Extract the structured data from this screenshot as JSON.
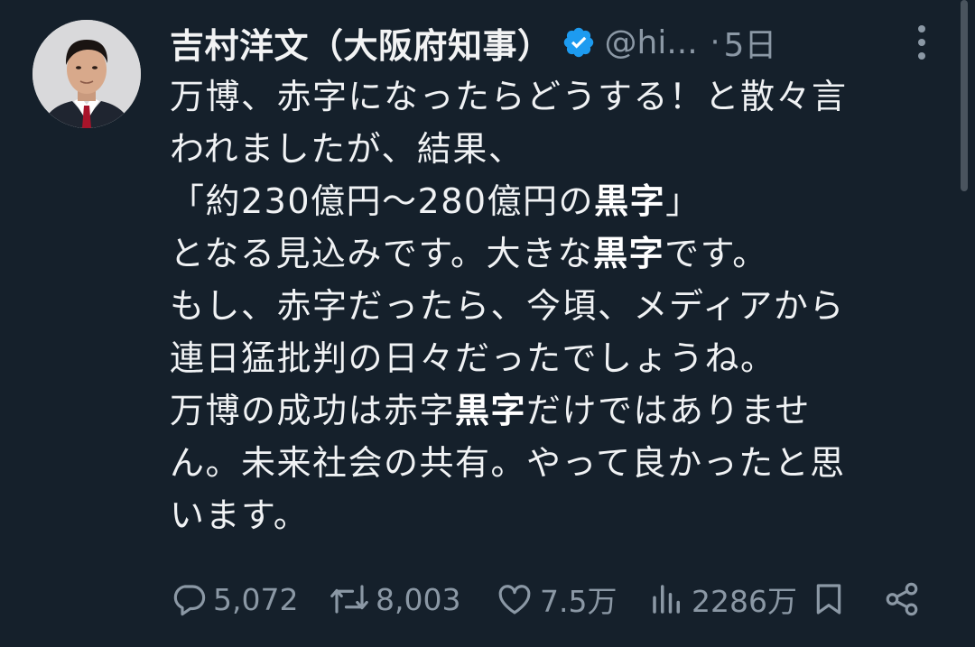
{
  "tweet": {
    "author_name": "吉村洋文（大阪府知事）",
    "handle": "@hi...",
    "separator": "·",
    "time": "5日",
    "lines": [
      [
        "万博、赤字になったらどうする！と散々言"
      ],
      [
        "われましたが、結果、"
      ],
      [
        "「約230億円〜280億円の",
        "黒字",
        "」"
      ],
      [
        "となる見込みです。大きな",
        "黒字",
        "です。"
      ],
      [
        "もし、赤字だったら、今頃、メディアから"
      ],
      [
        "連日猛批判の日々だったでしょうね。"
      ],
      [
        "万博の成功は赤字",
        "黒字",
        "だけではありませ"
      ],
      [
        "ん。未来社会の共有。やって良かったと思"
      ],
      [
        "います。"
      ]
    ],
    "stats": {
      "replies": "5,072",
      "reposts": "8,003",
      "likes": "7.5万",
      "views": "2286万"
    }
  },
  "icons": {
    "verified": "verified-badge-icon",
    "more": "more-vertical-icon",
    "reply": "reply-icon",
    "repost": "repost-icon",
    "like": "heart-icon",
    "views": "views-chart-icon",
    "bookmark": "bookmark-icon",
    "share": "share-icon"
  },
  "colors": {
    "background": "#15202b",
    "text": "#e7e9ea",
    "muted": "#8b98a5",
    "verified": "#1d9bf0"
  }
}
